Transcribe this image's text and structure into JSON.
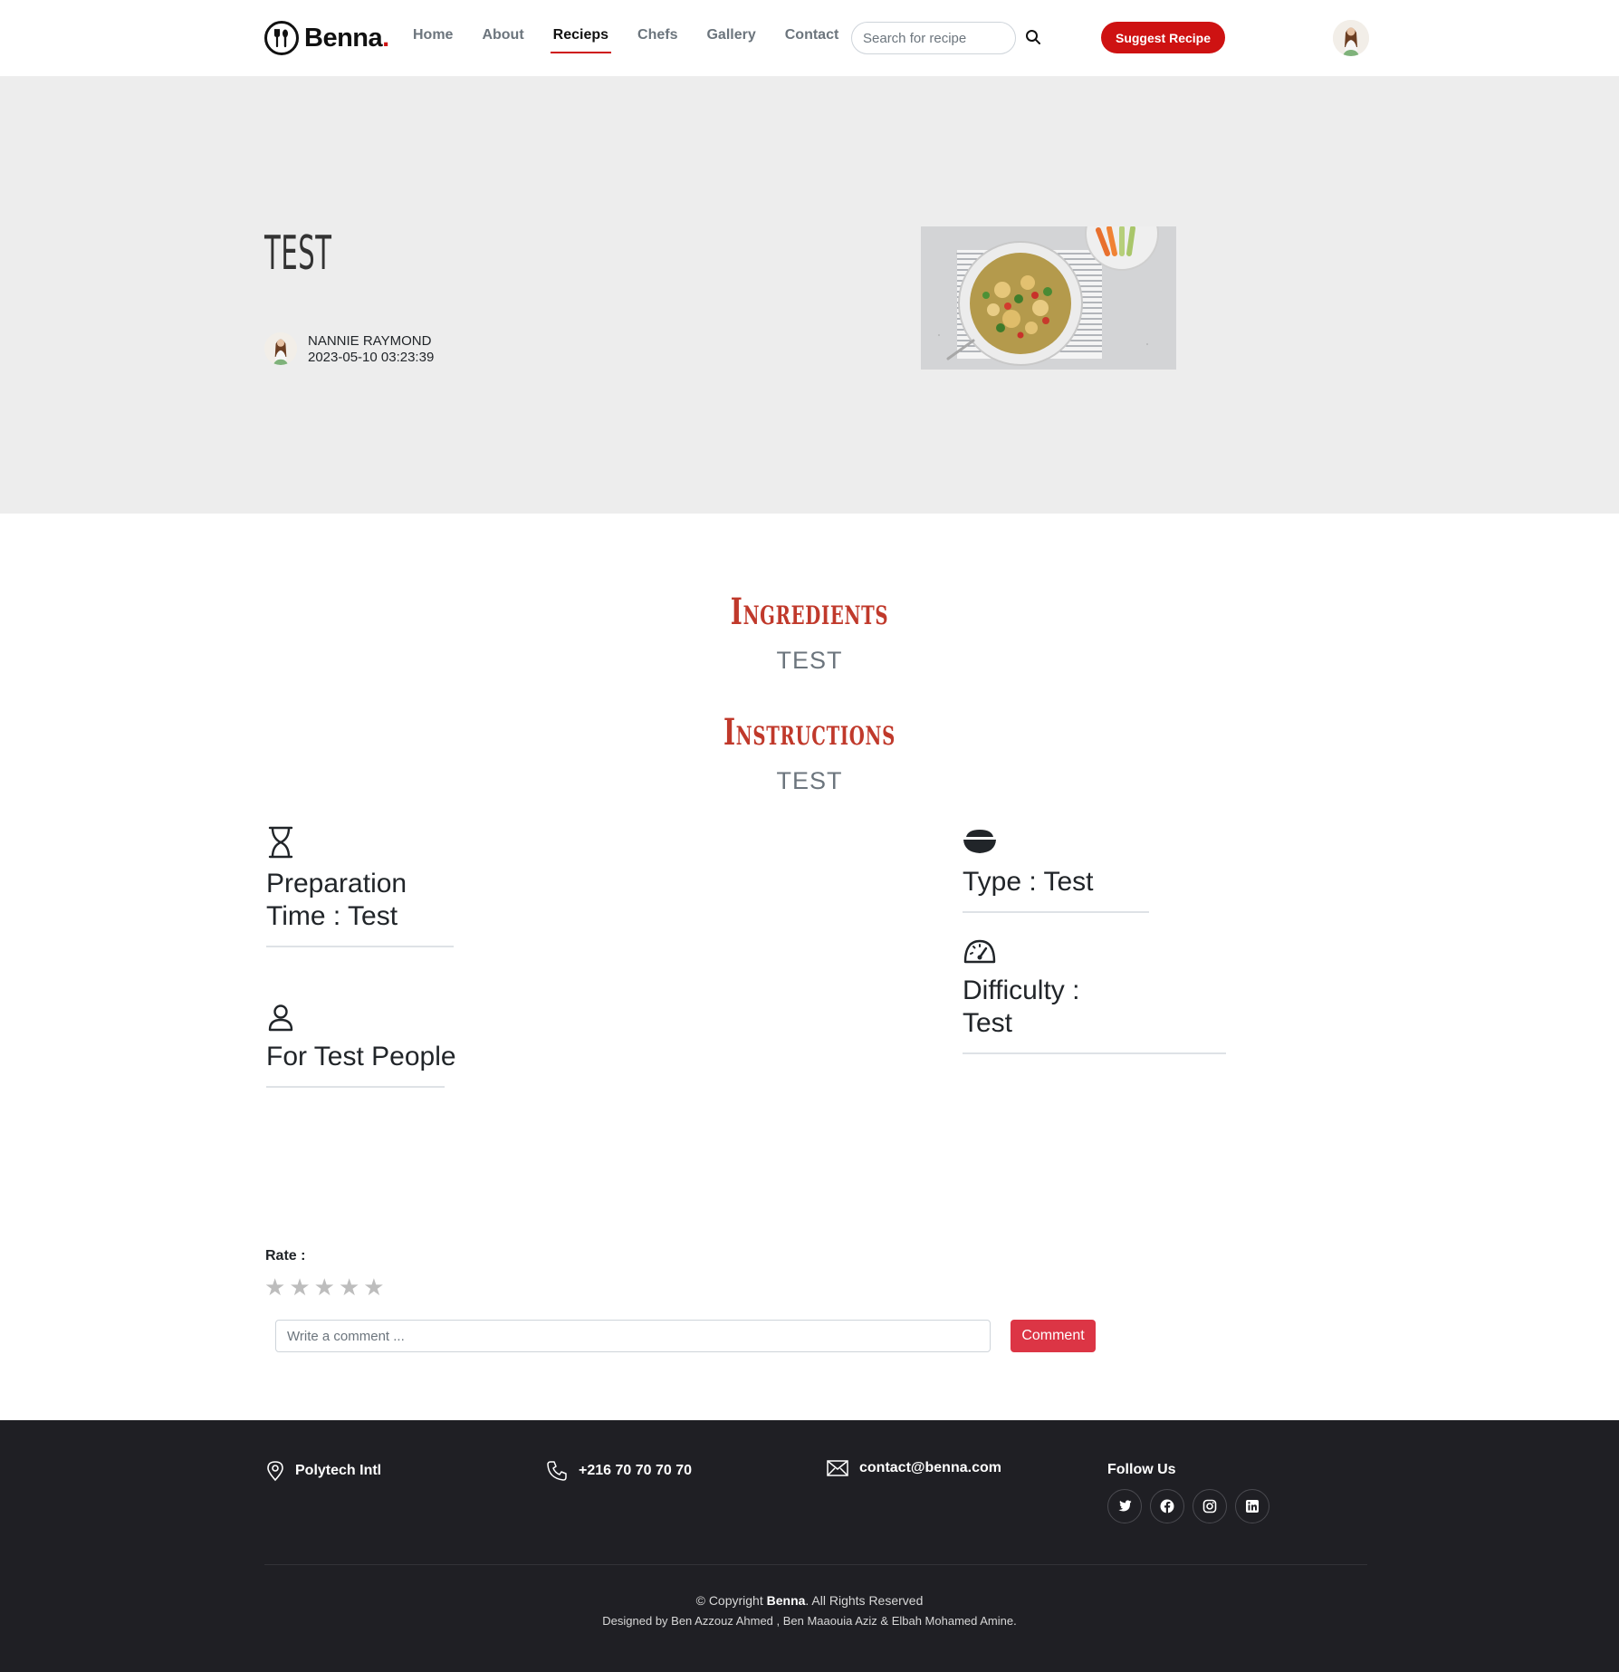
{
  "header": {
    "logo_text": "Benna",
    "logo_dot": ".",
    "nav": [
      {
        "label": "Home"
      },
      {
        "label": "About"
      },
      {
        "label": "Recieps"
      },
      {
        "label": "Chefs"
      },
      {
        "label": "Gallery"
      },
      {
        "label": "Contact"
      }
    ],
    "active_nav": "Recieps",
    "search_placeholder": "Search for recipe",
    "suggest_label": "Suggest Recipe"
  },
  "recipe": {
    "title": "TEST",
    "author_name": "NANNIE RAYMOND",
    "date": "2023-05-10 03:23:39",
    "image": "salad-bowl-photo"
  },
  "sections": {
    "ingredients_title": "Ingredients",
    "ingredients_text": "TEST",
    "instructions_title": "Instructions",
    "instructions_text": "TEST"
  },
  "info": {
    "prep_time": "Preparation Time : Test",
    "people": "For Test People",
    "type": "Type : Test",
    "difficulty": "Difficulty : Test"
  },
  "rating": {
    "label": "Rate :",
    "stars": [
      "★",
      "★",
      "★",
      "★",
      "★"
    ]
  },
  "comment": {
    "placeholder": "Write a comment ...",
    "button": "Comment"
  },
  "footer": {
    "address": "Polytech Intl",
    "phone": "+216 70 70 70 70",
    "email": "contact@benna.com",
    "follow_title": "Follow Us",
    "socials": [
      "twitter-icon",
      "facebook-icon",
      "instagram-icon",
      "linkedin-icon"
    ],
    "copyright_prefix": "© Copyright",
    "copyright_brand": "Benna",
    "copyright_suffix": ". All Rights Reserved",
    "credits": "Designed by Ben Azzouz Ahmed , Ben Maaouia Aziz & Elbah Mohamed Amine."
  },
  "colors": {
    "accent": "#ce1212",
    "hero_bg": "#ededed",
    "footer_bg": "#1f1f24"
  }
}
